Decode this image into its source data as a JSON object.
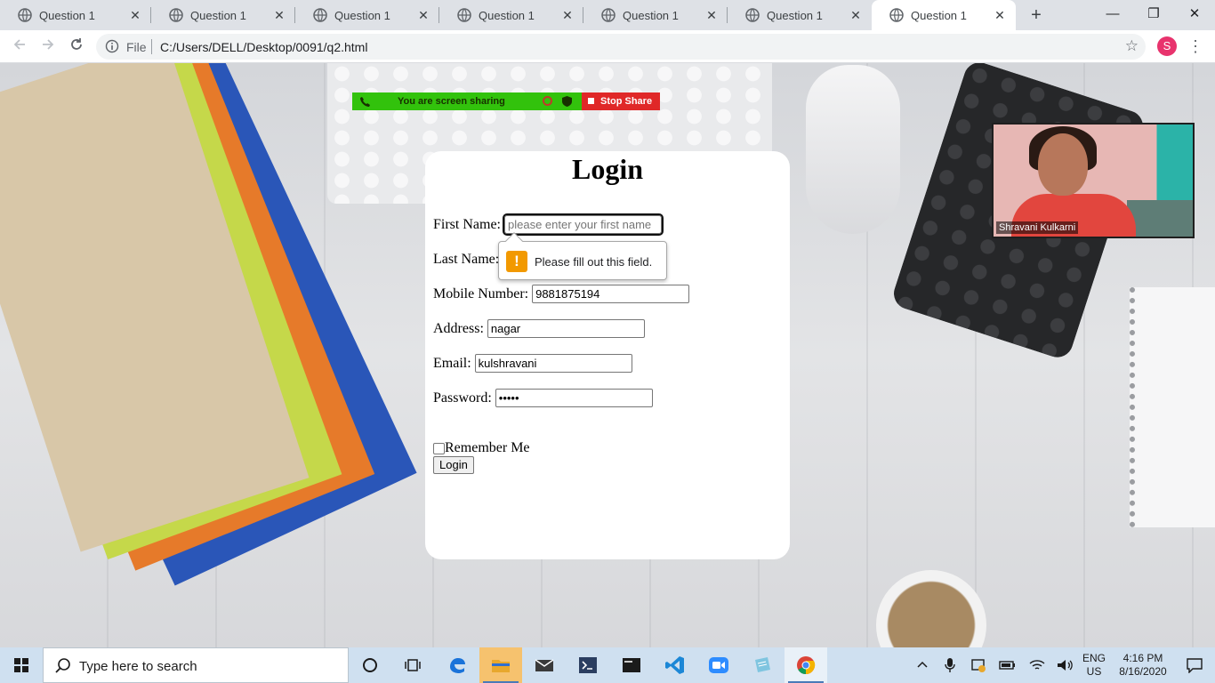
{
  "browser": {
    "tabs": [
      {
        "title": "Question 1",
        "active": false
      },
      {
        "title": "Question 1",
        "active": false
      },
      {
        "title": "Question 1",
        "active": false
      },
      {
        "title": "Question 1",
        "active": false
      },
      {
        "title": "Question 1",
        "active": false
      },
      {
        "title": "Question 1",
        "active": false
      },
      {
        "title": "Question 1",
        "active": true
      }
    ],
    "new_tab": "+",
    "window_controls": {
      "minimize": "—",
      "restore": "❐",
      "close": "✕"
    },
    "address": {
      "scheme_label": "File",
      "url": "C:/Users/DELL/Desktop/0091/q2.html"
    },
    "profile_initial": "S",
    "accent": "#e8336d"
  },
  "share_bar": {
    "message": "You are screen sharing",
    "stop_label": "Stop Share",
    "colors": {
      "bar": "#32c20c",
      "stop": "#e02828"
    }
  },
  "login_form": {
    "title": "Login",
    "fields": {
      "first_name": {
        "label": "First Name:",
        "placeholder": "please enter your first name",
        "value": ""
      },
      "last_name": {
        "label": "Last Name:",
        "value": ""
      },
      "mobile": {
        "label": "Mobile Number:",
        "value": "9881875194"
      },
      "address": {
        "label": "Address:",
        "value": "nagar"
      },
      "email": {
        "label": "Email:",
        "value": "kulshravani"
      },
      "password": {
        "label": "Password:",
        "value": "•••••"
      }
    },
    "remember_label": "Remember Me",
    "remember_checked": false,
    "submit_label": "Login"
  },
  "validation_tooltip": {
    "icon": "!",
    "message": "Please fill out this field."
  },
  "video_tile": {
    "participant_name": "Shravani Kulkarni"
  },
  "taskbar": {
    "search_placeholder": "Type here to search",
    "apps": [
      "task-view",
      "edge",
      "file-explorer",
      "mail",
      "powershell",
      "terminal",
      "vscode",
      "zoom",
      "sticky-app",
      "chrome"
    ],
    "language": {
      "line1": "ENG",
      "line2": "US"
    },
    "clock": {
      "time": "4:16 PM",
      "date": "8/16/2020"
    }
  }
}
